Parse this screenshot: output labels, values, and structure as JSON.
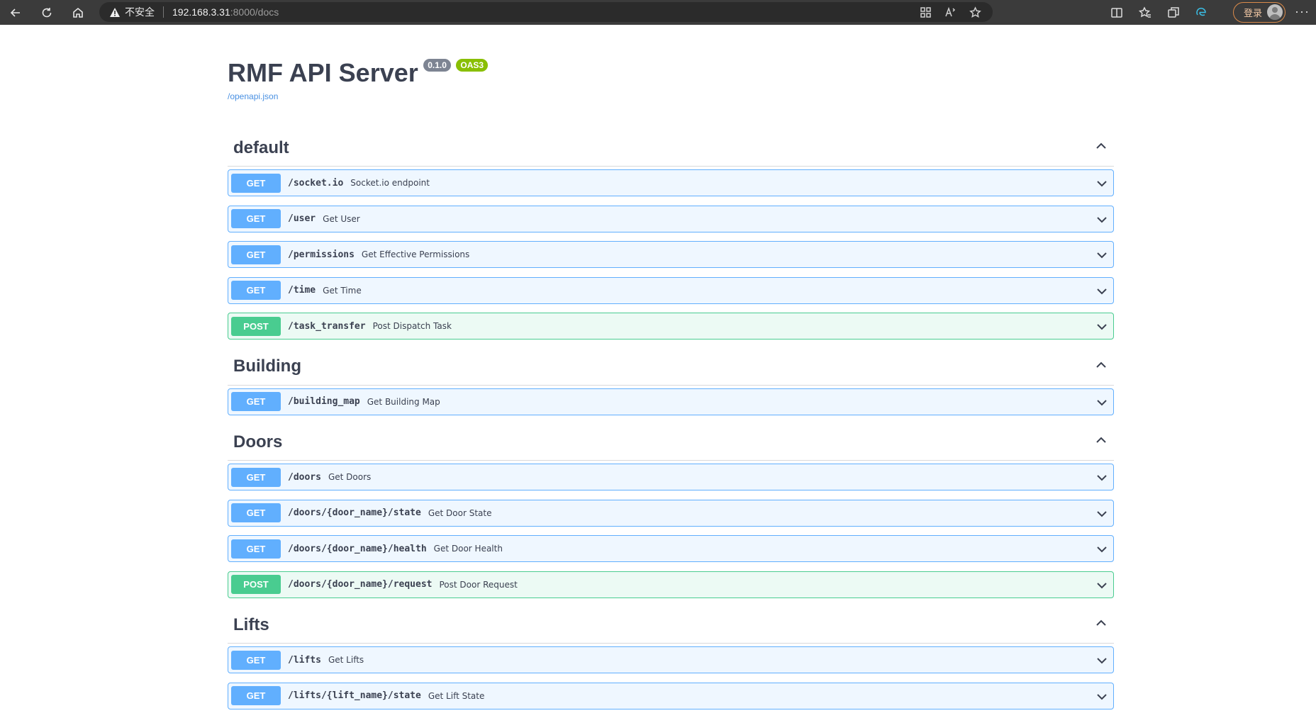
{
  "browser": {
    "security_warning": "不安全",
    "url_host": "192.168.3.31",
    "url_rest": ":8000/docs",
    "login_label": "登录",
    "more_label": "···"
  },
  "info": {
    "title": "RMF API Server",
    "version": "0.1.0",
    "oas": "OAS3",
    "spec_link": "/openapi.json"
  },
  "tags": [
    {
      "name": "default",
      "ops": [
        {
          "method": "GET",
          "path": "/socket.io",
          "summary": "Socket.io endpoint"
        },
        {
          "method": "GET",
          "path": "/user",
          "summary": "Get User"
        },
        {
          "method": "GET",
          "path": "/permissions",
          "summary": "Get Effective Permissions"
        },
        {
          "method": "GET",
          "path": "/time",
          "summary": "Get Time"
        },
        {
          "method": "POST",
          "path": "/task_transfer",
          "summary": "Post Dispatch Task"
        }
      ]
    },
    {
      "name": "Building",
      "ops": [
        {
          "method": "GET",
          "path": "/building_map",
          "summary": "Get Building Map"
        }
      ]
    },
    {
      "name": "Doors",
      "ops": [
        {
          "method": "GET",
          "path": "/doors",
          "summary": "Get Doors"
        },
        {
          "method": "GET",
          "path": "/doors/{door_name}/state",
          "summary": "Get Door State"
        },
        {
          "method": "GET",
          "path": "/doors/{door_name}/health",
          "summary": "Get Door Health"
        },
        {
          "method": "POST",
          "path": "/doors/{door_name}/request",
          "summary": "Post Door Request"
        }
      ]
    },
    {
      "name": "Lifts",
      "ops": [
        {
          "method": "GET",
          "path": "/lifts",
          "summary": "Get Lifts"
        },
        {
          "method": "GET",
          "path": "/lifts/{lift_name}/state",
          "summary": "Get Lift State"
        }
      ]
    }
  ]
}
